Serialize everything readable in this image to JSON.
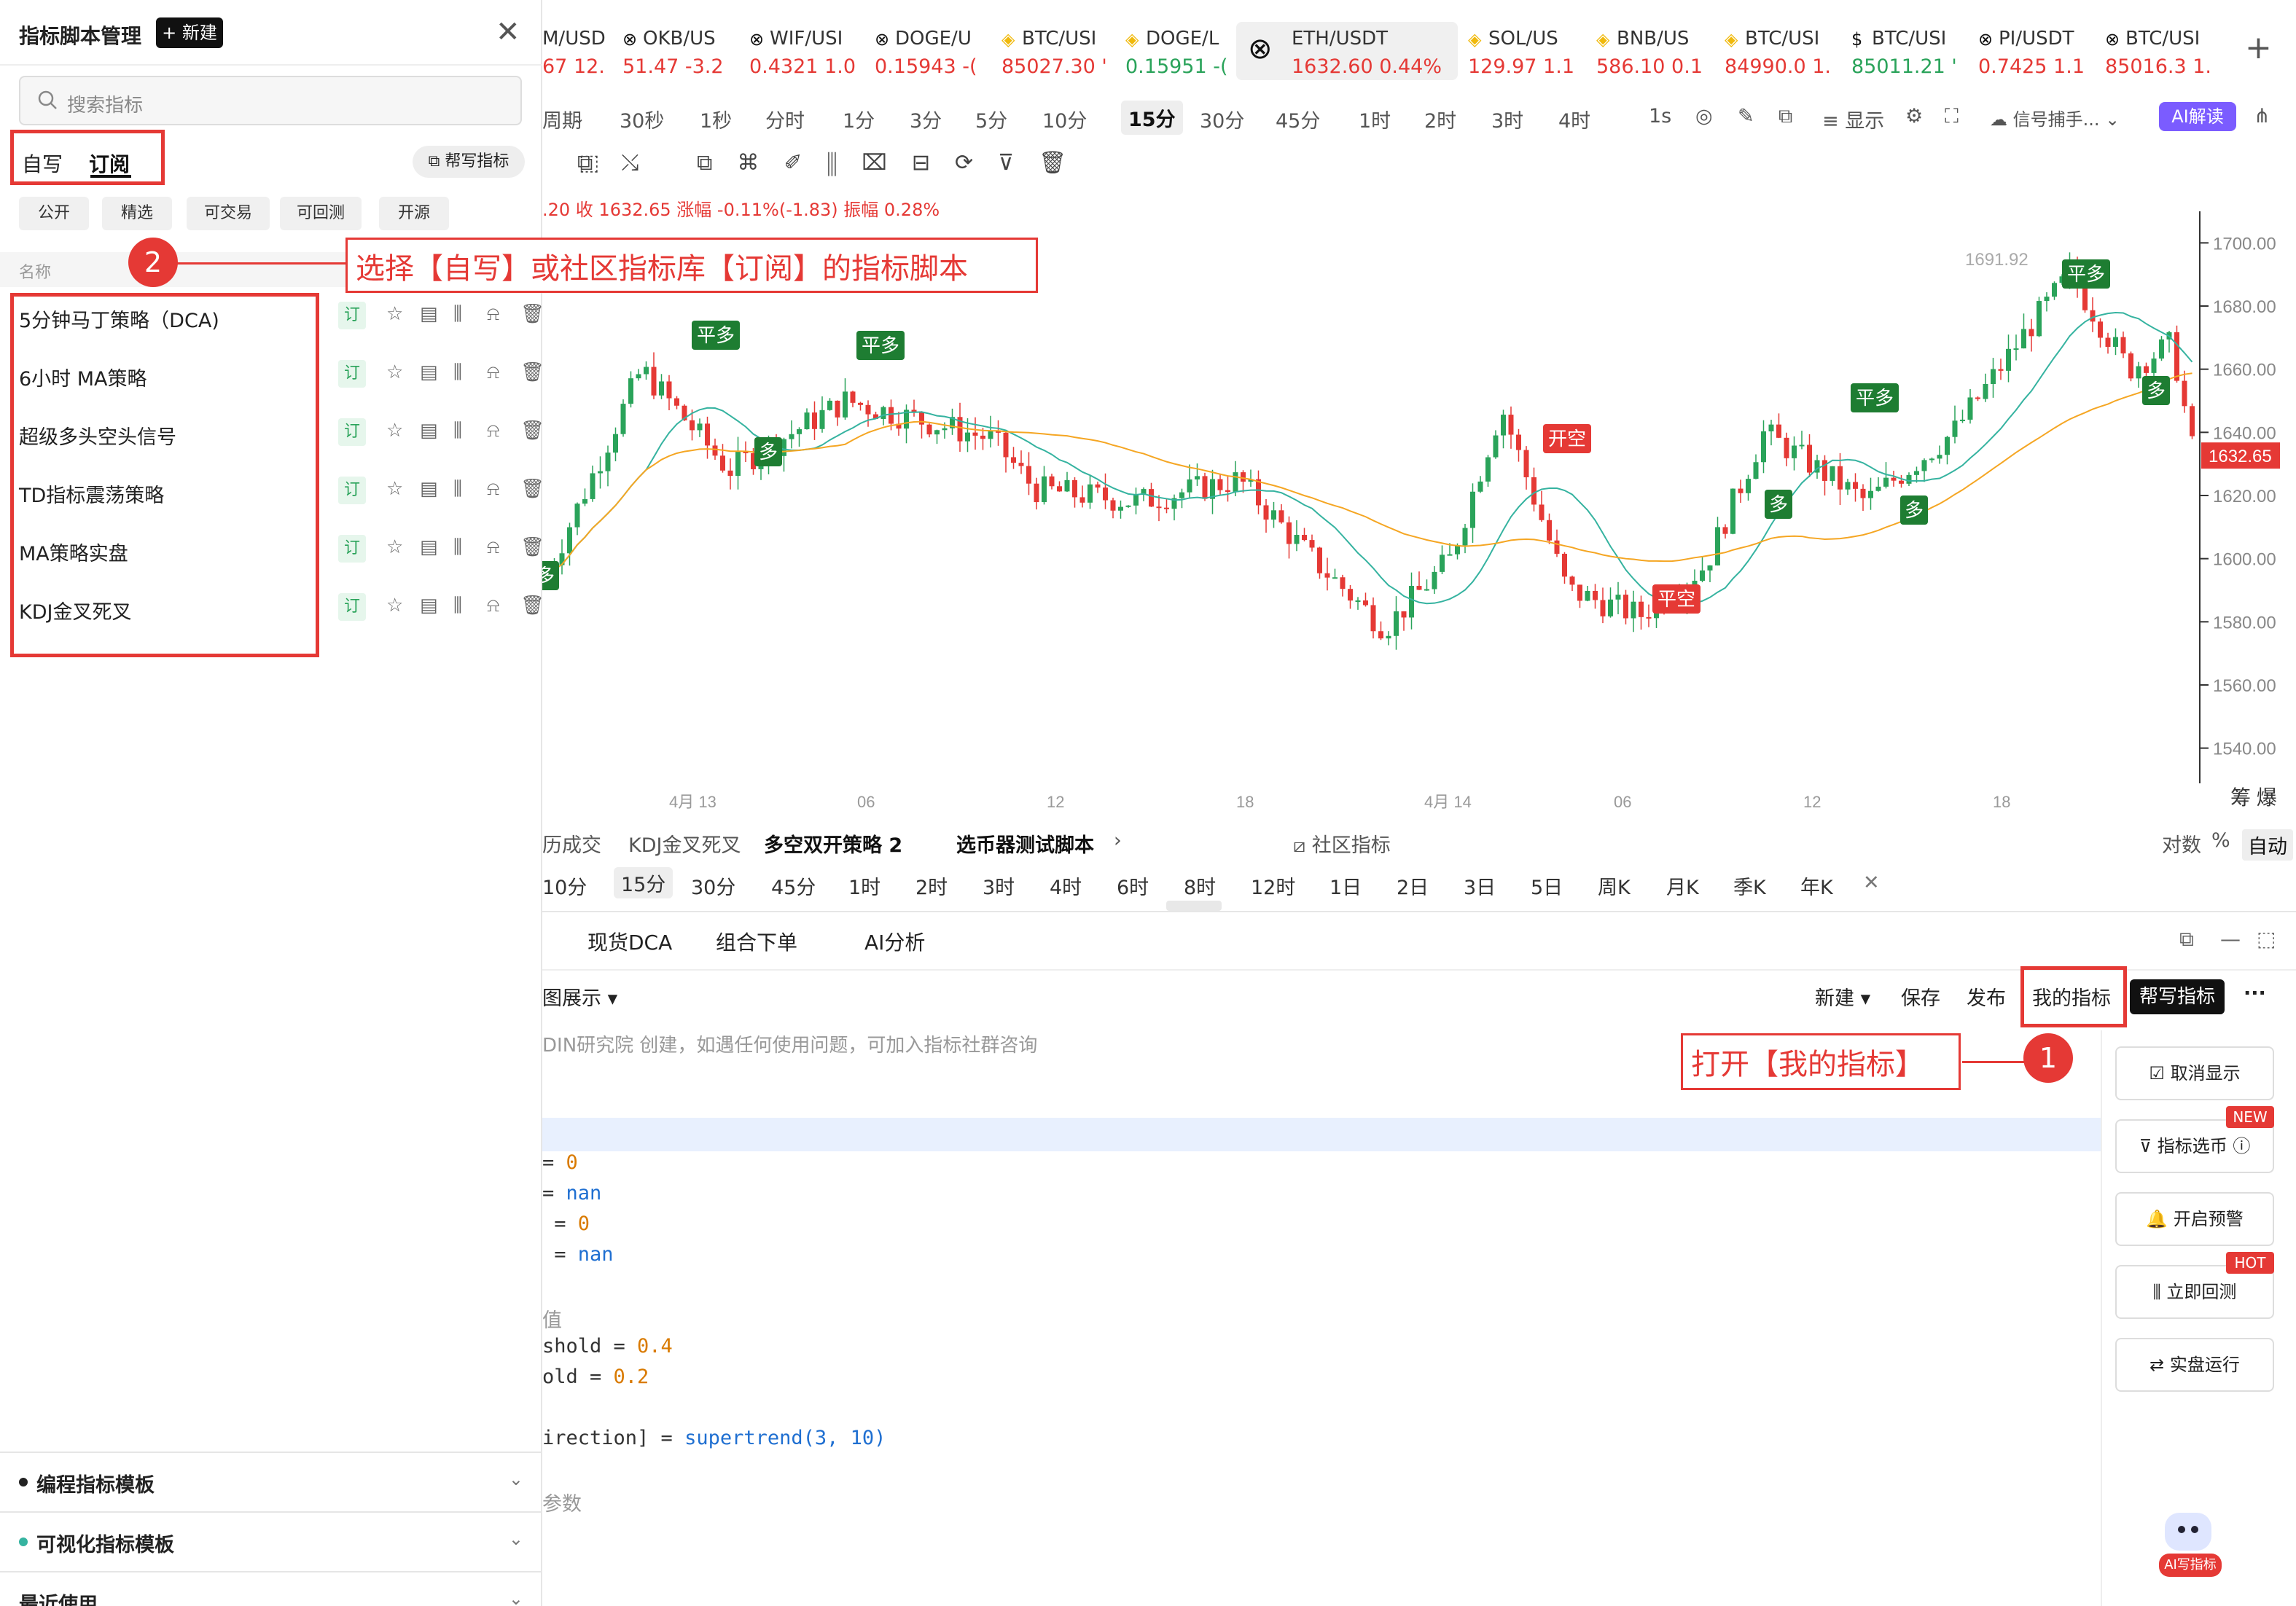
{
  "left_panel": {
    "title": "指标脚本管理",
    "new_button": "+ 新建",
    "close": "✕",
    "search_placeholder": "搜索指标",
    "tabs": [
      "自写",
      "订阅"
    ],
    "help_button": "帮写指标",
    "filters": [
      "公开",
      "精选",
      "可交易",
      "可回测",
      "开源"
    ],
    "column_header": "名称",
    "scripts": [
      {
        "name": "5分钟马丁策略（DCA)",
        "badge": "订"
      },
      {
        "name": "6小时 MA策略",
        "badge": "订"
      },
      {
        "name": "超级多头空头信号",
        "badge": "订"
      },
      {
        "name": "TD指标震荡策略",
        "badge": "订"
      },
      {
        "name": "MA策略实盘",
        "badge": "订"
      },
      {
        "name": "KDJ金叉死叉",
        "badge": "订"
      }
    ],
    "accordions": [
      "编程指标模板",
      "可视化指标模板",
      "最近使用"
    ]
  },
  "annotations": {
    "step2_num": "2",
    "step2_text": "选择【自写】或社区指标库【订阅】的指标脚本",
    "step1_num": "1",
    "step1_text": "打开【我的指标】"
  },
  "tickers": [
    {
      "sym": "M/USD",
      "px": "67  12.",
      "dir": "dn"
    },
    {
      "sym": "OKB/US",
      "px": "51.47  -3.2",
      "dir": "dn"
    },
    {
      "sym": "WIF/USI",
      "px": "0.4321  1.0",
      "dir": "dn"
    },
    {
      "sym": "DOGE/U",
      "px": "0.15943  -(",
      "dir": "dn"
    },
    {
      "sym": "BTC/USI",
      "px": "85027.30  '",
      "dir": "dn"
    },
    {
      "sym": "DOGE/L",
      "px": "0.15951  -(",
      "dir": "up"
    },
    {
      "sym": "ETH/USDT",
      "px": "1632.60  0.44%",
      "dir": "dn"
    },
    {
      "sym": "SOL/US",
      "px": "129.97  1.1",
      "dir": "dn"
    },
    {
      "sym": "BNB/US",
      "px": "586.10  0.1",
      "dir": "dn"
    },
    {
      "sym": "BTC/USI",
      "px": "84990.0  1.",
      "dir": "dn"
    },
    {
      "sym": "BTC/USI",
      "px": "85011.21  '",
      "dir": "up"
    },
    {
      "sym": "PI/USDT",
      "px": "0.7425  1.1",
      "dir": "dn"
    },
    {
      "sym": "BTC/USI",
      "px": "85016.3  1.",
      "dir": "dn"
    }
  ],
  "intervals": [
    "周期",
    "30秒",
    "1秒",
    "分时",
    "1分",
    "3分",
    "5分",
    "10分",
    "15分",
    "30分",
    "45分",
    "1时",
    "2时",
    "3时",
    "4时"
  ],
  "interval_extra": {
    "one_sec": "1s",
    "display": "显示",
    "signal": "信号捕手...",
    "ai_read": "AI解读"
  },
  "ohlc_line": {
    "part1": ".20  收 1632.65  涨幅 -0.11%(-1.83)  振幅 0.28%"
  },
  "chart_labels": {
    "price_axis": [
      "1700.00",
      "1680.00",
      "1660.00",
      "1640.00",
      "1620.00",
      "1600.00",
      "1580.00",
      "1560.00",
      "1540.00"
    ],
    "current_price": "1632.65",
    "high_label": "1691.92",
    "time_axis": [
      "4月 13",
      "06",
      "12",
      "18",
      "4月 14",
      "06",
      "12",
      "18"
    ],
    "corner": "筹  爆",
    "signals": [
      "平多",
      "平多",
      "多",
      "开空",
      "平空",
      "平多",
      "多",
      "多",
      "平多",
      "多",
      "多"
    ]
  },
  "script_tabs": [
    "历成交",
    "KDJ金叉死叉",
    "多空双开策略 2",
    "选币器测试脚本",
    "社区指标"
  ],
  "scale_opts": [
    "对数",
    "%",
    "自动"
  ],
  "range_tabs": [
    "10分",
    "15分",
    "30分",
    "45分",
    "1时",
    "2时",
    "3时",
    "4时",
    "6时",
    "8时",
    "12时",
    "1日",
    "2日",
    "3日",
    "5日",
    "周K",
    "月K",
    "季K",
    "年K"
  ],
  "section_tabs": [
    "现货DCA",
    "组合下单",
    "AI分析"
  ],
  "editor": {
    "mode": "图展示",
    "actions": [
      "新建",
      "保存",
      "发布"
    ],
    "my_indicator": "我的指标",
    "help_write": "帮写指标",
    "notice": "DIN研究院 创建，如遇任何使用问题，可加入指标社群咨询",
    "code_lines": [
      {
        "a": "= ",
        "b": "0"
      },
      {
        "a": "= ",
        "b": "nan"
      },
      {
        "a": " = ",
        "b": "0"
      },
      {
        "a": " = ",
        "b": "nan"
      },
      {
        "a": "值",
        "b": ""
      },
      {
        "a": "shold = ",
        "b": "0.4"
      },
      {
        "a": "old = ",
        "b": "0.2"
      },
      {
        "a": "irection] = ",
        "b": "supertrend(3, 10)"
      },
      {
        "a": "参数",
        "b": ""
      }
    ]
  },
  "side_buttons": [
    {
      "label": "取消显示",
      "tag": ""
    },
    {
      "label": "指标选币 ⓘ",
      "tag": "NEW"
    },
    {
      "label": "开启预警",
      "tag": ""
    },
    {
      "label": "立即回测",
      "tag": "HOT"
    },
    {
      "label": "实盘运行",
      "tag": ""
    }
  ],
  "ai_write": "AI写指标",
  "colors": {
    "up": "#2aa35a",
    "down": "#e53935",
    "ma_fast": "#35b3a0",
    "ma_slow": "#f5a623",
    "annotation": "#e53935"
  }
}
